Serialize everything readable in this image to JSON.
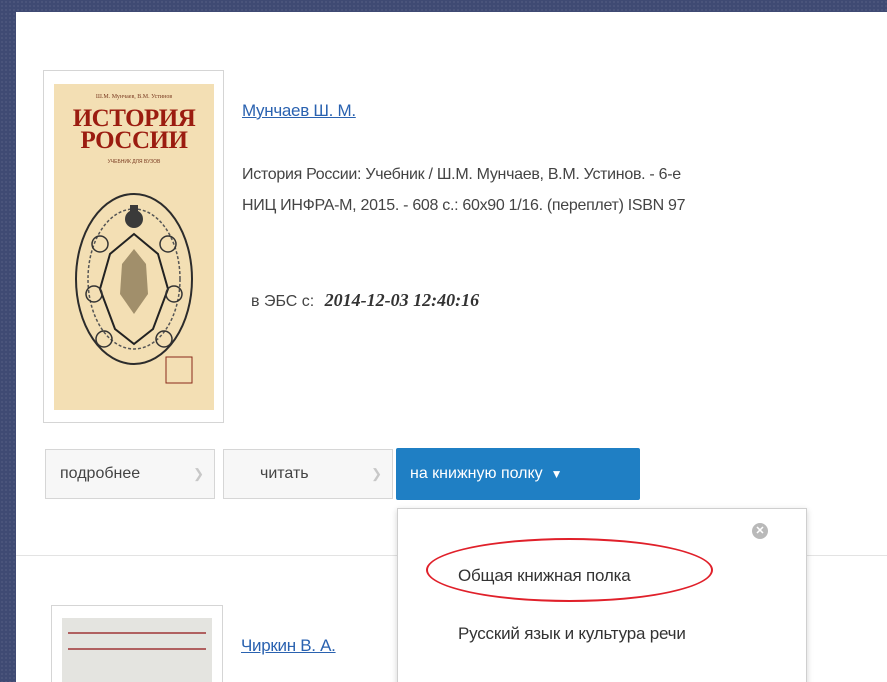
{
  "book1": {
    "cover_authors": "Ш.М. Мунчаев, В.М. Устинов",
    "cover_title_line1": "ИСТОРИЯ",
    "cover_title_line2": "РОССИИ",
    "cover_subtitle": "УЧЕБНИК ДЛЯ ВУЗОВ",
    "author": "Мунчаев Ш. М.",
    "description_line1": "История России: Учебник / Ш.М. Мунчаев, В.М. Устинов. - 6-е",
    "description_line2": "НИЦ ИНФРА-М, 2015. - 608 с.: 60x90 1/16. (переплет) ISBN 97",
    "ebs_label": "в ЭБС с:",
    "ebs_date": "2014-12-03 12:40:16"
  },
  "buttons": {
    "details": "подробнее",
    "read": "читать",
    "shelf": "на книжную полку"
  },
  "dropdown": {
    "items": [
      "Общая книжная полка",
      "Русский язык и культура речи"
    ]
  },
  "book2": {
    "author": "Чиркин В. А."
  },
  "colors": {
    "link": "#2a62b0",
    "primary_button": "#1f7fc4",
    "highlight": "#e0202a",
    "background": "#3f4a73"
  },
  "icons": {
    "chevron": "chevron-right-icon",
    "caret": "caret-down-icon",
    "close": "close-circle-icon"
  }
}
